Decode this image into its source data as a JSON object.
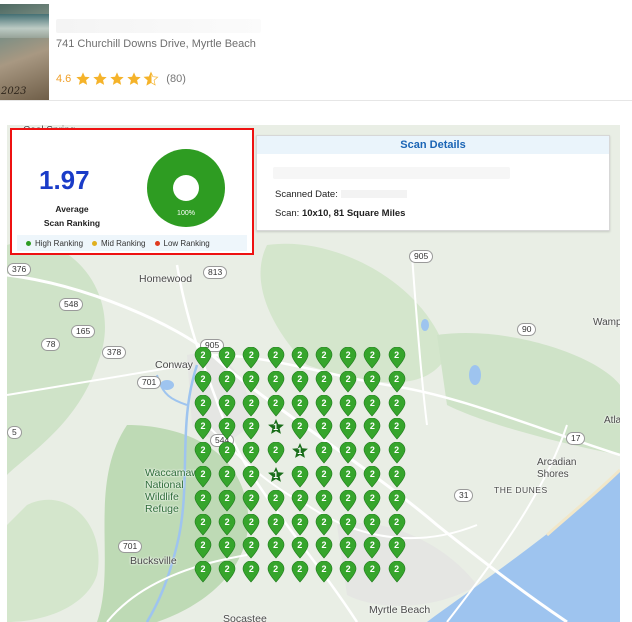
{
  "business": {
    "address": "741 Churchill Downs Drive, Myrtle Beach",
    "rating": "4.6",
    "stars": 4.5,
    "review_count": "(80)",
    "thumb_caption": "2023"
  },
  "summary": {
    "average_value": "1.97",
    "average_label_line1": "Average",
    "average_label_line2": "Scan Ranking",
    "donut_percent_label": "100%",
    "donut_color": "#2e9c22",
    "legend": [
      {
        "label": "High Ranking",
        "color": "#2e9c22"
      },
      {
        "label": "Mid Ranking",
        "color": "#e0b020"
      },
      {
        "label": "Low Ranking",
        "color": "#e03a1e"
      }
    ]
  },
  "scan_details": {
    "title": "Scan Details",
    "scanned_date_label": "Scanned Date:",
    "scan_label": "Scan:",
    "scan_value": "10x10, 81 Square Miles"
  },
  "map": {
    "place_labels": [
      "Cool Spring",
      "Homewood",
      "Conway",
      "Waccamaw National Wildlife Refuge",
      "Bucksville",
      "Socastee",
      "Myrtle Beach",
      "Arcadian Shores",
      "THE DUNES",
      "Atla",
      "Wamp"
    ],
    "route_labels": [
      "905",
      "813",
      "548",
      "165",
      "78",
      "378",
      "701",
      "544",
      "90",
      "31",
      "17",
      "376",
      "5",
      "905",
      "701"
    ]
  },
  "grid": {
    "pin_color": "#36a52c",
    "top_pin_color": "#1a6e1a",
    "rows": [
      [
        "2",
        "2",
        "2",
        "2",
        "2",
        "2",
        "2",
        "2",
        "2"
      ],
      [
        "2",
        "2",
        "2",
        "2",
        "2",
        "2",
        "2",
        "2",
        "2"
      ],
      [
        "2",
        "2",
        "2",
        "2",
        "2",
        "2",
        "2",
        "2",
        "2"
      ],
      [
        "2",
        "2",
        "2",
        "1",
        "2",
        "2",
        "2",
        "2",
        "2"
      ],
      [
        "2",
        "2",
        "2",
        "2",
        "1",
        "2",
        "2",
        "2",
        "2"
      ],
      [
        "2",
        "2",
        "2",
        "1",
        "2",
        "2",
        "2",
        "2",
        "2"
      ],
      [
        "2",
        "2",
        "2",
        "2",
        "2",
        "2",
        "2",
        "2",
        "2"
      ],
      [
        "2",
        "2",
        "2",
        "2",
        "2",
        "2",
        "2",
        "2",
        "2"
      ],
      [
        "2",
        "2",
        "2",
        "2",
        "2",
        "2",
        "2",
        "2",
        "2"
      ],
      [
        "2",
        "2",
        "2",
        "2",
        "2",
        "2",
        "2",
        "2",
        "2"
      ]
    ]
  }
}
